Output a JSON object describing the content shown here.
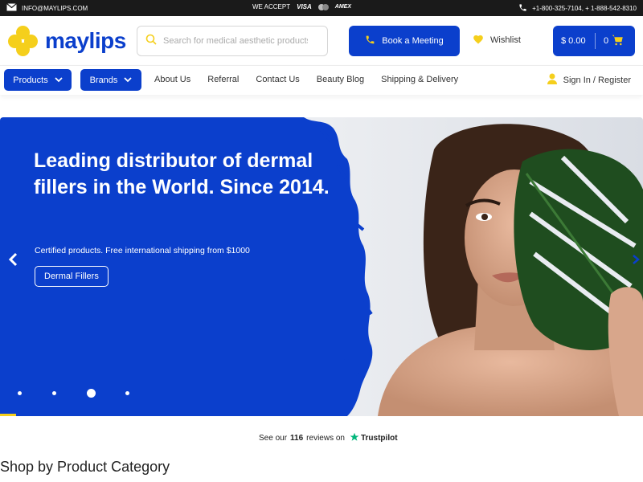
{
  "topbar": {
    "email": "INFO@MAYLIPS.COM",
    "accept_label": "WE ACCEPT",
    "card_visa": "VISA",
    "card_amex": "AMEX",
    "phones": "+1-800-325-7104, + 1-888-542-8310"
  },
  "header": {
    "logo_text": "maylips",
    "search_placeholder": "Search for medical aesthetic products",
    "meeting_label": "Book a Meeting",
    "wishlist_label": "Wishlist",
    "cart_amount": "$ 0.00",
    "cart_count": "0"
  },
  "nav": {
    "products_label": "Products",
    "brands_label": "Brands",
    "links": [
      "About Us",
      "Referral",
      "Contact Us",
      "Beauty Blog",
      "Shipping & Delivery"
    ],
    "signin_label": "Sign In / Register"
  },
  "hero": {
    "title": "Leading distributor of dermal fillers in the World. Since 2014.",
    "subtitle": "Certified products. Free international shipping from $1000",
    "cta_label": "Dermal Fillers",
    "slide_count": 4,
    "active_slide": 3
  },
  "trustpilot": {
    "prefix": "See our",
    "count": "116",
    "suffix": "reviews on",
    "brand": "Trustpilot"
  },
  "section": {
    "title": "Shop by Product Category"
  },
  "colors": {
    "brand_blue": "#0b3fcc",
    "brand_yellow": "#f5cf1c",
    "topbar_bg": "#1a1a1a",
    "trustpilot_green": "#00b67a"
  }
}
